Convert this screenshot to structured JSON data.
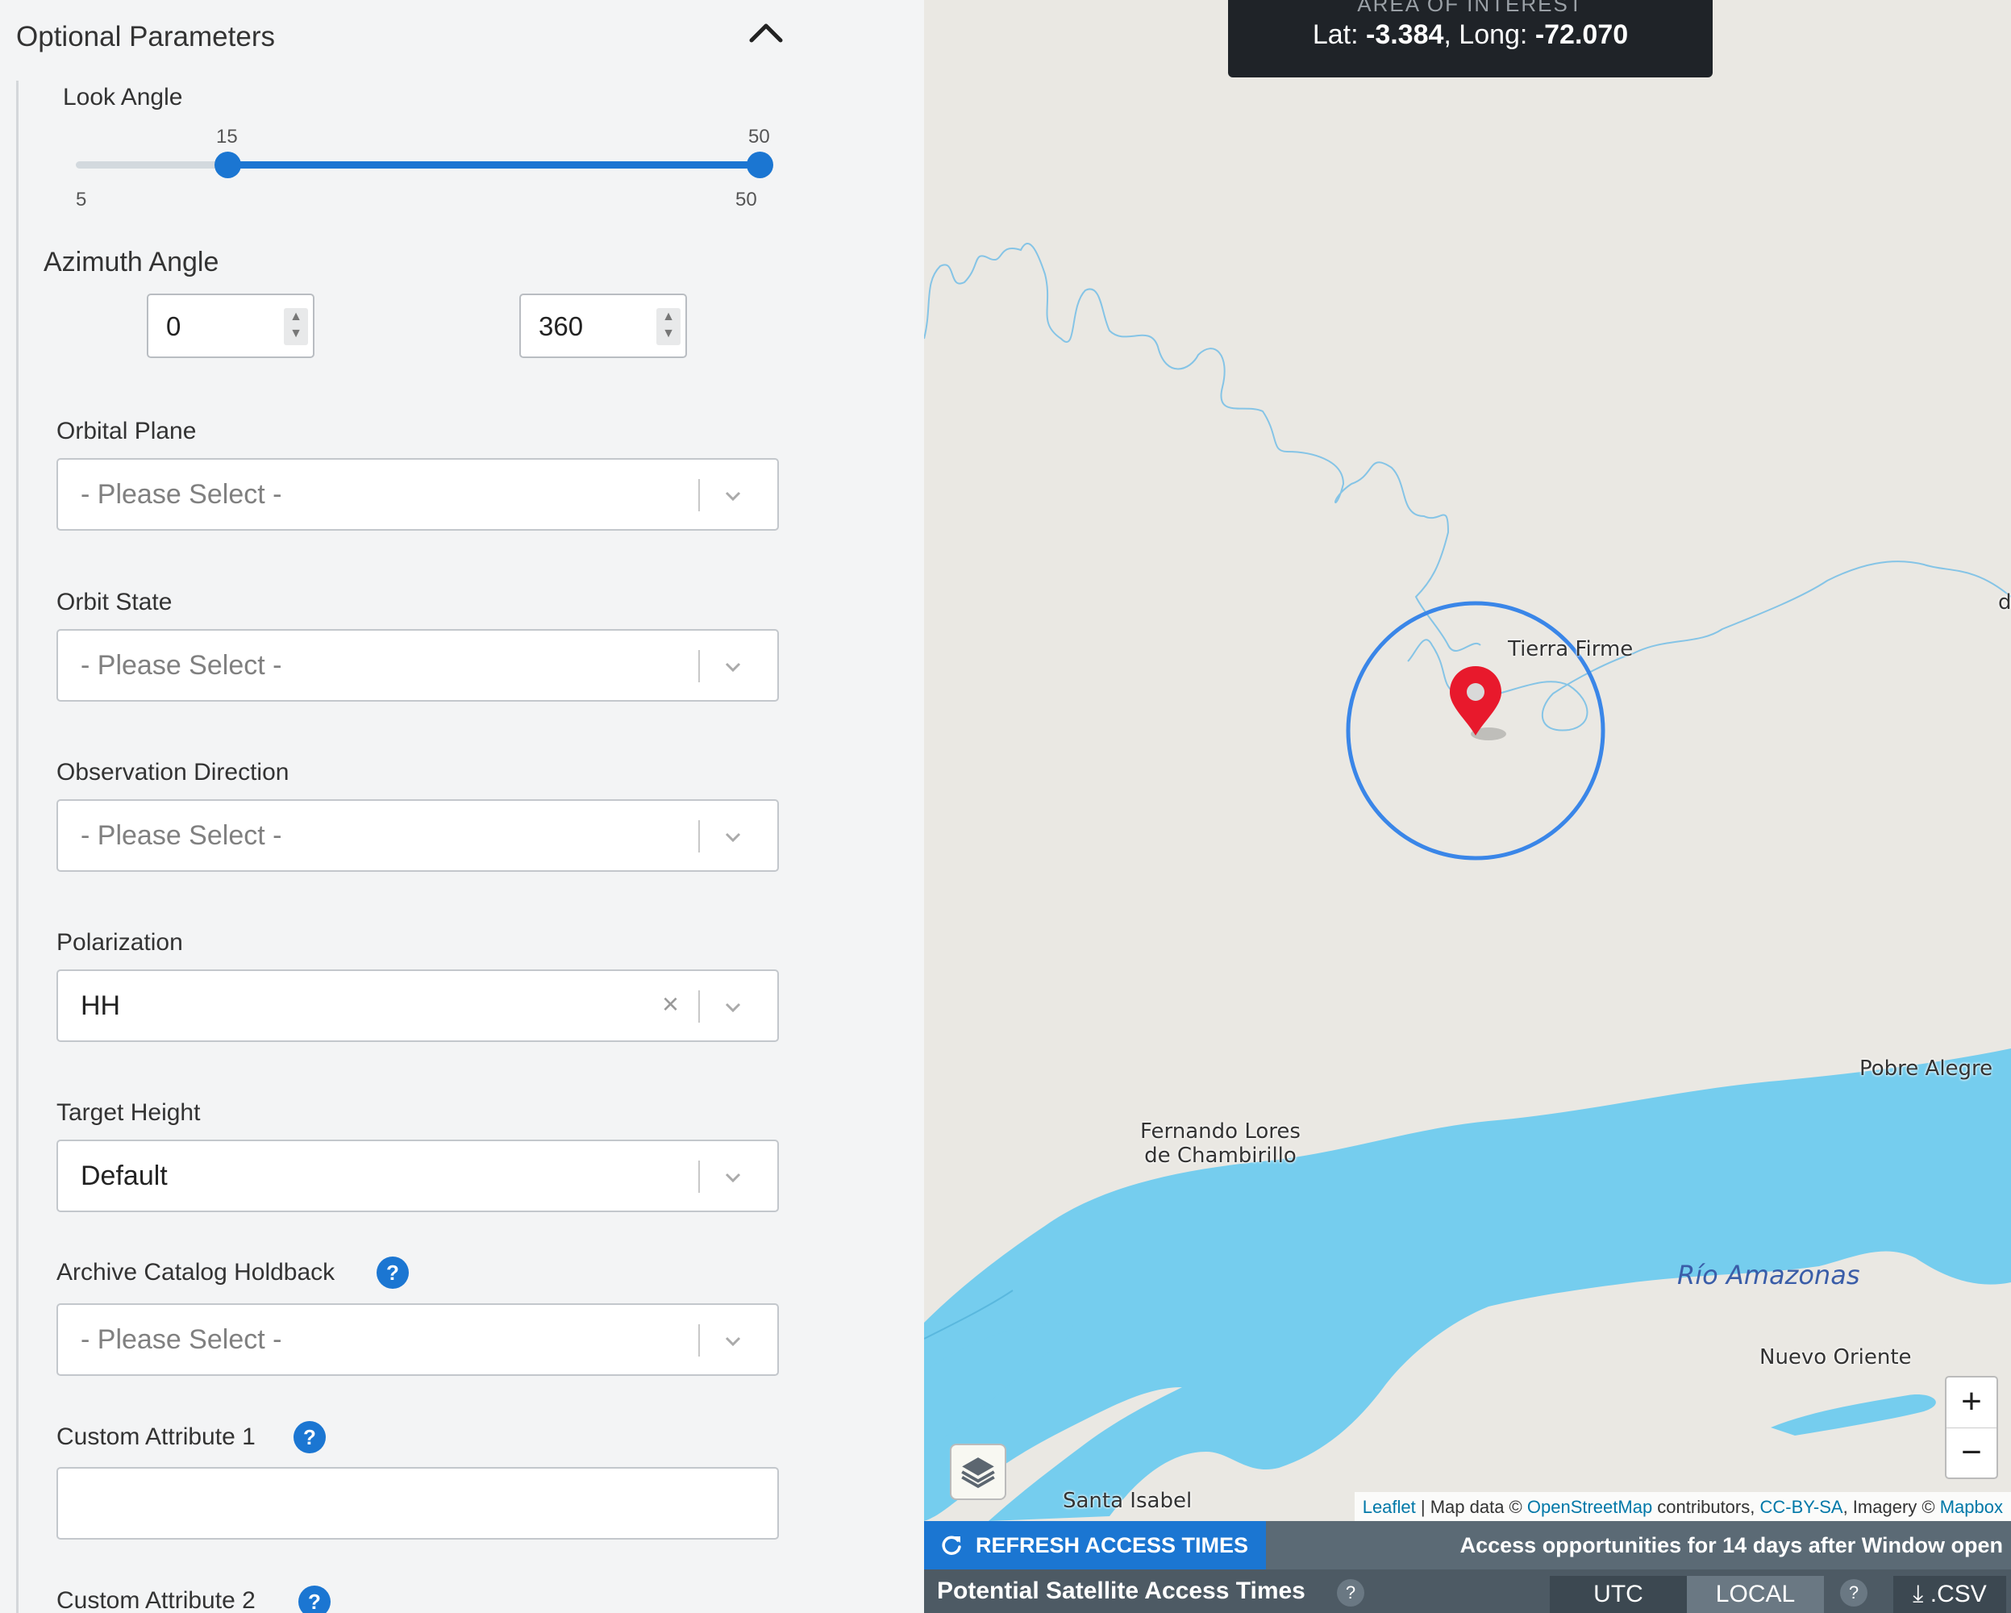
{
  "panel": {
    "section_title": "Optional Parameters",
    "look_angle": {
      "label": "Look Angle",
      "range_min": "5",
      "range_max": "50",
      "low_value": "15",
      "high_value": "50",
      "min": 5,
      "max": 50,
      "low": 15,
      "high": 50
    },
    "azimuth": {
      "label": "Azimuth Angle",
      "from": "0",
      "to": "360"
    },
    "orbital_plane": {
      "label": "Orbital Plane",
      "placeholder": "- Please Select -"
    },
    "orbit_state": {
      "label": "Orbit State",
      "placeholder": "- Please Select -"
    },
    "observation_direction": {
      "label": "Observation Direction",
      "placeholder": "- Please Select -"
    },
    "polarization": {
      "label": "Polarization",
      "value": "HH"
    },
    "target_height": {
      "label": "Target Height",
      "value": "Default"
    },
    "archive_catalog_holdback": {
      "label": "Archive Catalog Holdback",
      "placeholder": "- Please Select -"
    },
    "custom_attribute_1": {
      "label": "Custom Attribute 1",
      "value": ""
    },
    "custom_attribute_2": {
      "label": "Custom Attribute 2"
    },
    "help_glyph": "?"
  },
  "map": {
    "aoi_title": "AREA OF INTEREST",
    "lat_label": "Lat: ",
    "lat_value": "-3.384",
    "long_label": ", Long: ",
    "long_value": "-72.070",
    "places": {
      "tierra_firme": "Tierra Firme",
      "fernando_1": "Fernando Lores",
      "fernando_2": "de Chambirillo",
      "pobre_alegre": "Pobre Alegre",
      "nuevo_oriente": "Nuevo Oriente",
      "santa_isabel": "Santa Isabel",
      "edge_d": "d"
    },
    "river_label": "Río Amazonas",
    "zoom_in": "+",
    "zoom_out": "−",
    "attribution": {
      "leaflet": "Leaflet",
      "sep1": " | Map data © ",
      "osm": "OpenStreetMap",
      "contributors": " contributors, ",
      "ccbysa": "CC-BY-SA",
      "imagery": ", Imagery © ",
      "mapbox": "Mapbox"
    },
    "colors": {
      "water": "#75cdee",
      "land": "#eae8e3",
      "circle": "#3a86e8",
      "marker": "#e8192c"
    }
  },
  "bottom": {
    "refresh_label": "REFRESH ACCESS TIMES",
    "access_note": "Access opportunities for 14 days after Window open",
    "title": "Potential Satellite Access Times",
    "help": "?",
    "utc": "UTC",
    "local": "LOCAL",
    "csv": ".CSV"
  }
}
